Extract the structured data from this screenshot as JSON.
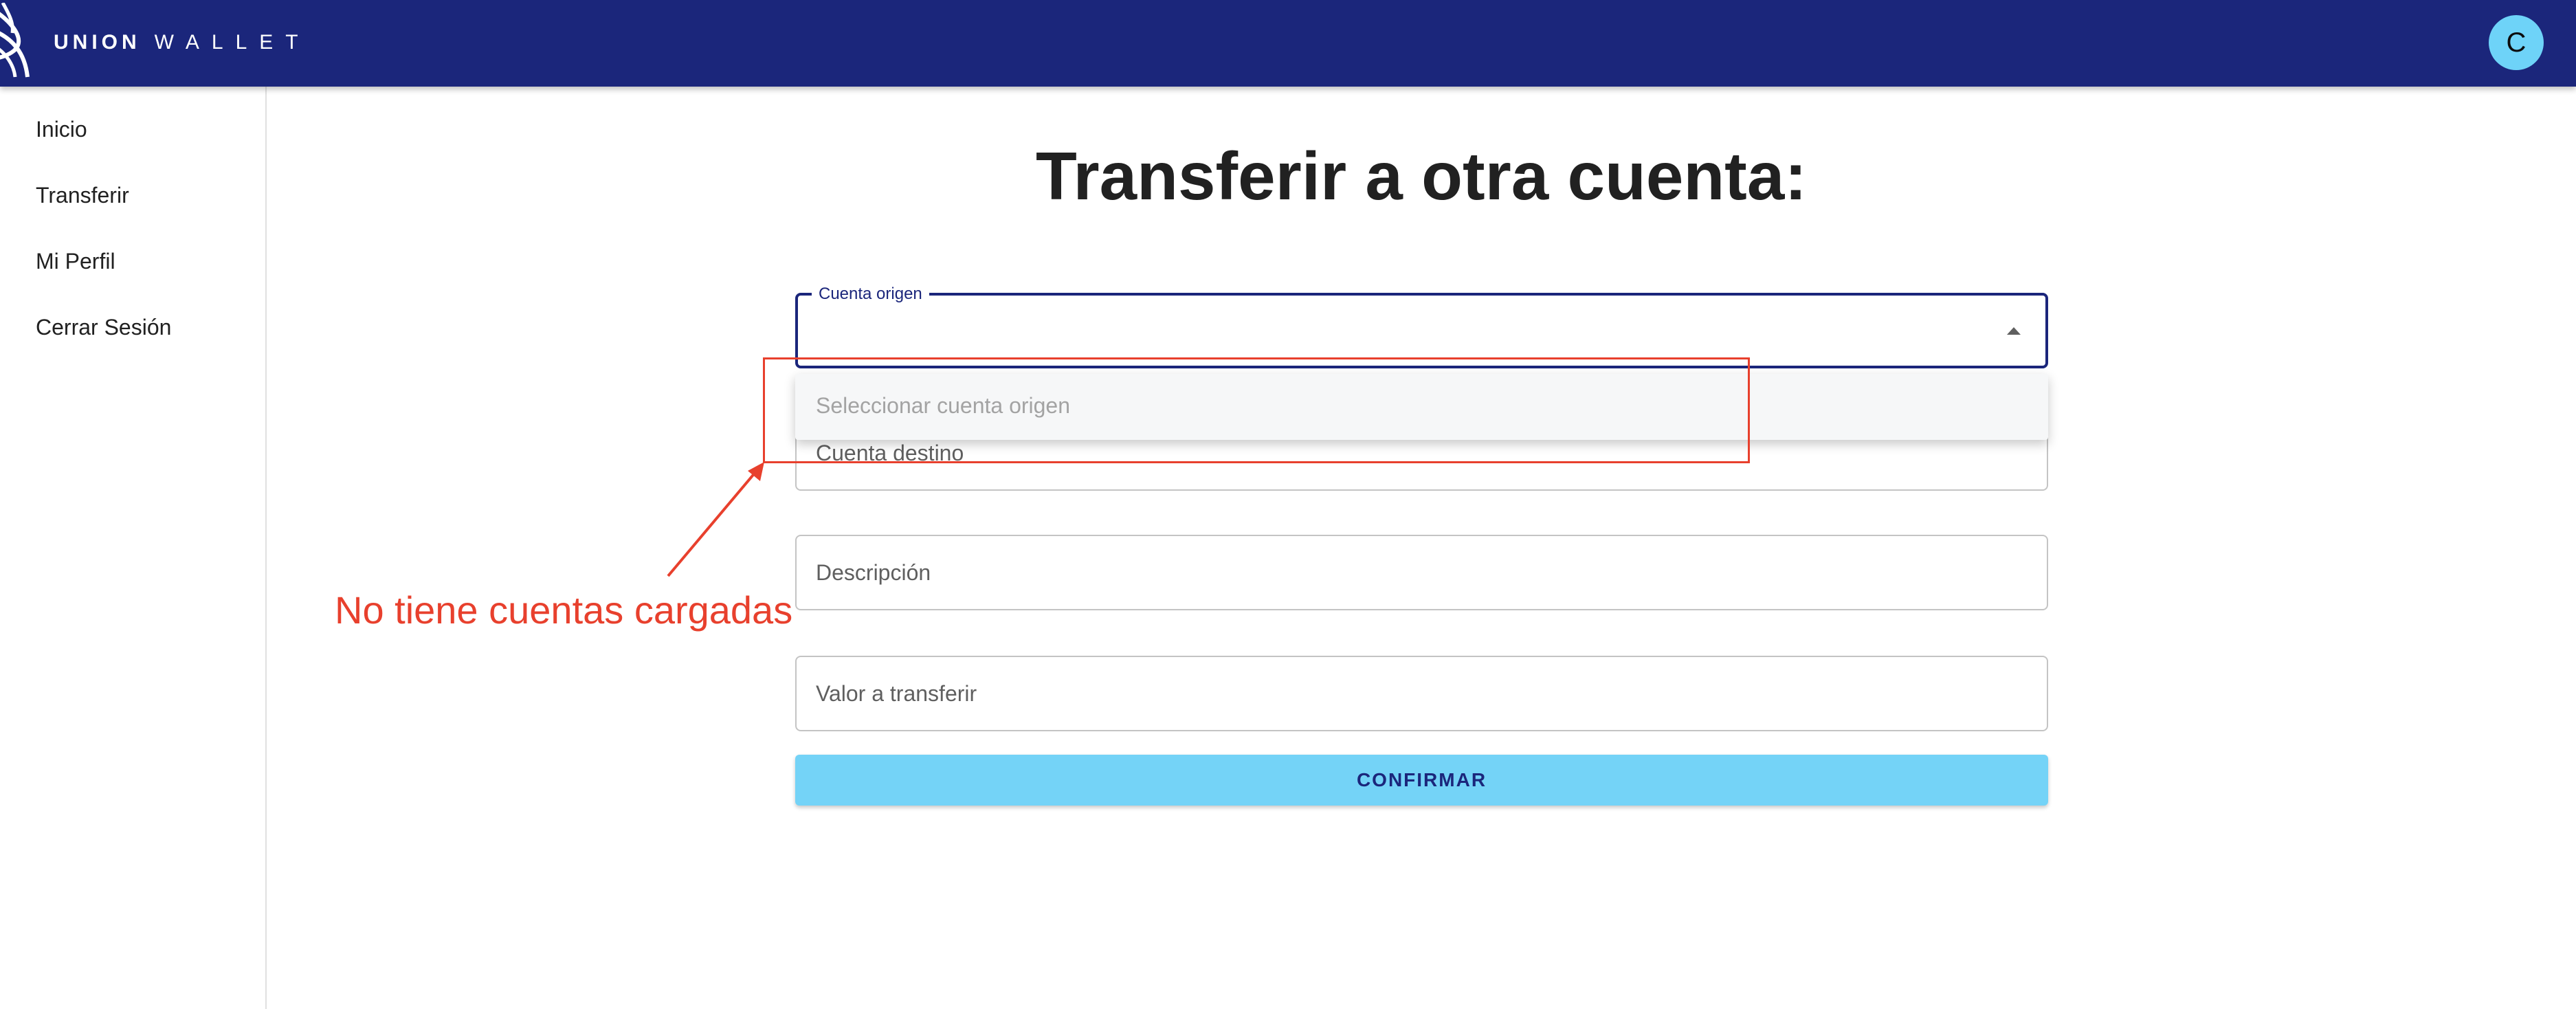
{
  "header": {
    "brand_strong": "UNION",
    "brand_light": "WALLET",
    "avatar_initial": "C",
    "logo_icon": "union-wallet-logo-icon",
    "background_color": "#1b267b"
  },
  "sidebar": {
    "items": [
      {
        "label": "Inicio"
      },
      {
        "label": "Transferir"
      },
      {
        "label": "Mi Perfil"
      },
      {
        "label": "Cerrar Sesión"
      }
    ]
  },
  "main": {
    "title": "Transferir a otra cuenta:",
    "origin_account": {
      "label": "Cuenta origen",
      "value": "",
      "dropdown_open": true,
      "options": [
        {
          "label": "Seleccionar cuenta origen"
        }
      ]
    },
    "destination_account": {
      "placeholder": "Cuenta destino"
    },
    "description": {
      "placeholder": "Descripción"
    },
    "amount": {
      "placeholder": "Valor a transferir"
    },
    "confirm_label": "CONFIRMAR",
    "accent_color": "#74d3f7"
  },
  "annotation": {
    "text": "No tiene cuentas cargadas",
    "color": "#e8402d"
  }
}
